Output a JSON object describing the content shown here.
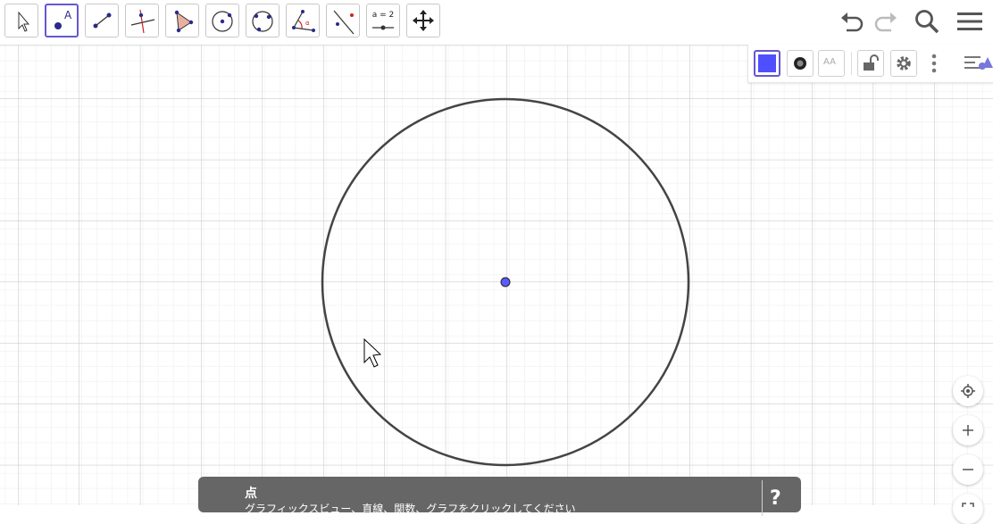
{
  "toolbar": {
    "tools": [
      {
        "name": "move-tool-button",
        "label": ""
      },
      {
        "name": "point-tool-button",
        "label": ""
      },
      {
        "name": "segment-tool-button",
        "label": ""
      },
      {
        "name": "perpendicular-line-tool-button",
        "label": ""
      },
      {
        "name": "polygon-tool-button",
        "label": ""
      },
      {
        "name": "circle-center-point-tool-button",
        "label": ""
      },
      {
        "name": "circle-three-points-tool-button",
        "label": ""
      },
      {
        "name": "angle-tool-button",
        "label": ""
      },
      {
        "name": "reflect-about-line-tool-button",
        "label": ""
      },
      {
        "name": "slider-tool-button",
        "label": "a = 2"
      },
      {
        "name": "move-graphics-view-tool-button",
        "label": ""
      }
    ],
    "selected_tool": "point-tool-button"
  },
  "stylebar": {
    "color_swatch": "#4f4fff",
    "text_size_label": "AA"
  },
  "colors": {
    "accent": "#6557d2",
    "point": "#5b5bff",
    "circle": "#444444",
    "grid_major": "#c2c2c2",
    "grid_minor": "#ececec",
    "tooltip_bg": "#666666"
  },
  "tooltip": {
    "title": "点",
    "description": "グラフィックスビュー、直線、関数、グラフをクリックしてください",
    "help": "?"
  }
}
